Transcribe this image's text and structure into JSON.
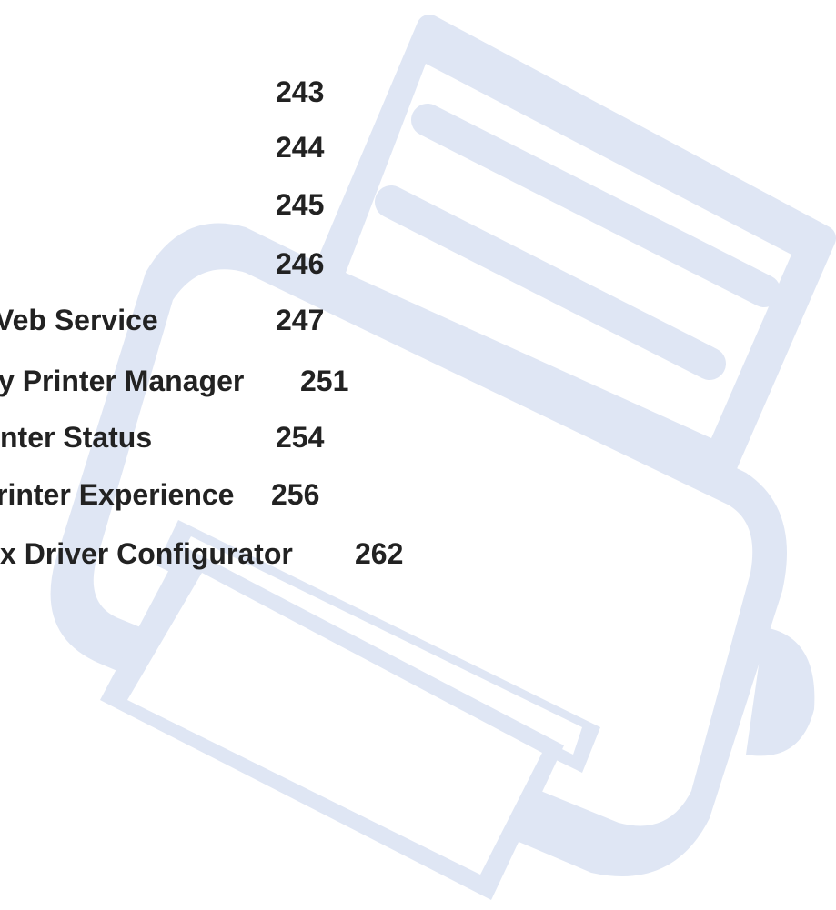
{
  "colors": {
    "background": "#ffffff",
    "text": "#222222",
    "art_fill": "#dfe6f4",
    "art_inner": "#ffffff"
  },
  "decoration": {
    "icon": "printer-illustration"
  },
  "toc": {
    "entries": [
      {
        "title": "",
        "page": "243"
      },
      {
        "title": "",
        "page": "244"
      },
      {
        "title": "",
        "page": "245"
      },
      {
        "title": "",
        "page": "246"
      },
      {
        "title": "Veb Service",
        "page": "247"
      },
      {
        "title": "y Printer Manager",
        "page": "251"
      },
      {
        "title": "nter Status",
        "page": "254"
      },
      {
        "title": "rinter Experience",
        "page": "256"
      },
      {
        "title": "x Driver Configurator",
        "page": "262"
      }
    ]
  }
}
